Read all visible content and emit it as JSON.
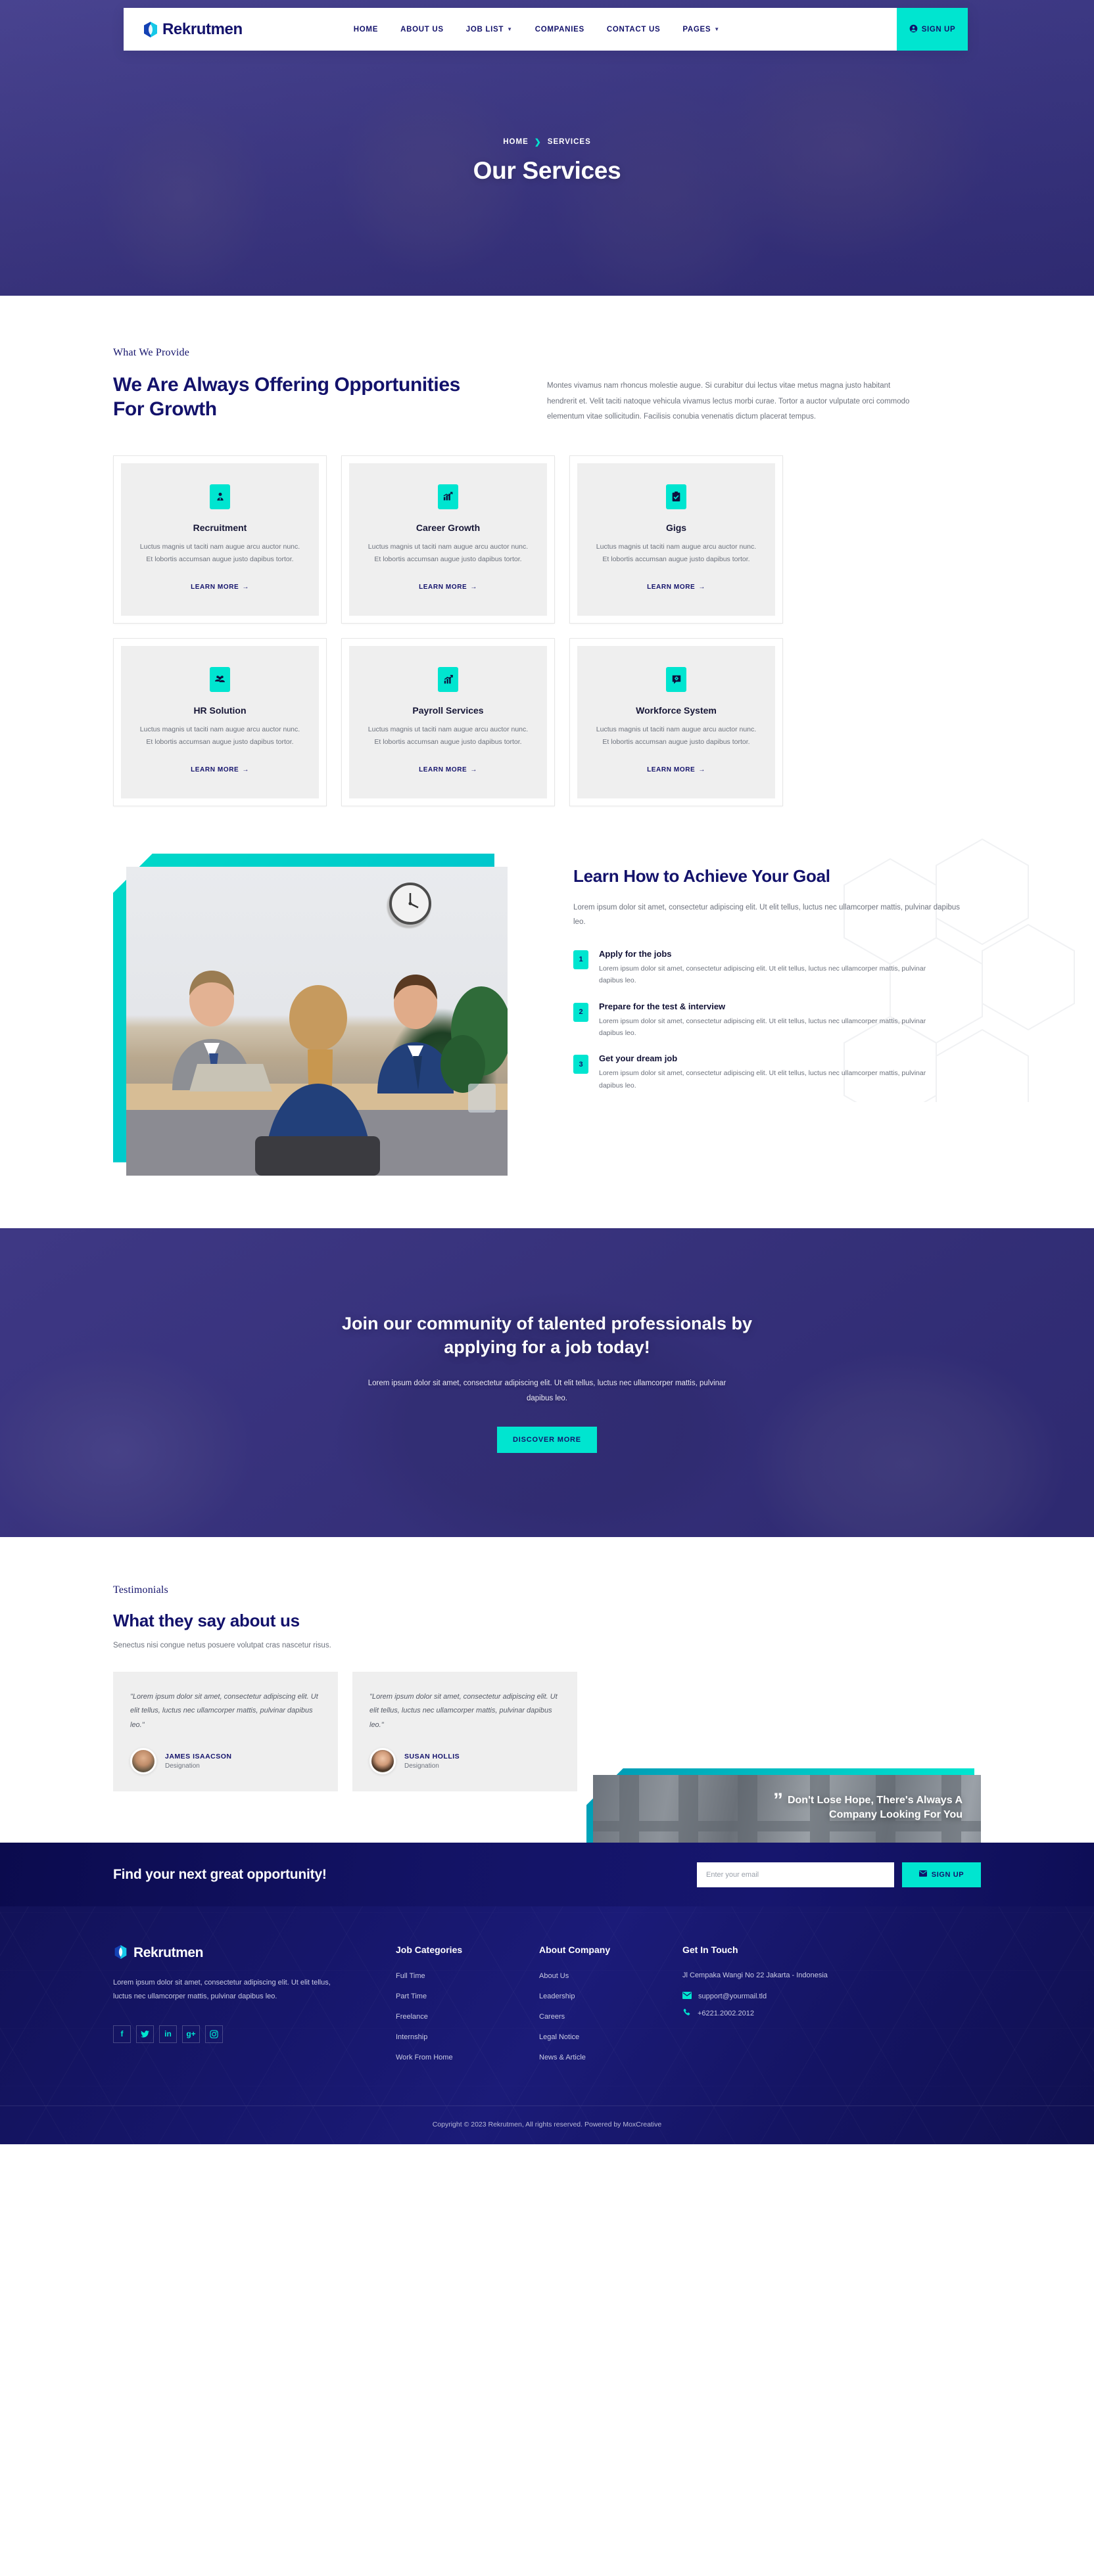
{
  "colors": {
    "navy": "#13126b",
    "teal": "#00e5d0",
    "card_bg": "#efefef",
    "footer_bg": "#16166a"
  },
  "navbar": {
    "brand": "Rekrutmen",
    "links": [
      {
        "label": "HOME",
        "caret": false
      },
      {
        "label": "ABOUT US",
        "caret": false
      },
      {
        "label": "JOB LIST",
        "caret": true
      },
      {
        "label": "COMPANIES",
        "caret": false
      },
      {
        "label": "CONTACT US",
        "caret": false
      },
      {
        "label": "PAGES",
        "caret": true
      }
    ],
    "signup_label": "SIGN UP"
  },
  "hero": {
    "breadcrumb_home": "HOME",
    "breadcrumb_sep": "❯",
    "breadcrumb_current": "SERVICES",
    "title": "Our Services"
  },
  "provide": {
    "eyebrow": "What We Provide",
    "heading": "We Are Always Offering Opportunities For Growth",
    "paragraph": "Montes vivamus nam rhoncus molestie augue. Si curabitur dui lectus vitae metus magna justo habitant hendrerit et. Velit taciti natoque vehicula vivamus lectus morbi curae. Tortor a auctor vulputate orci commodo elementum vitae sollicitudin. Facilisis conubia venenatis dictum placerat tempus.",
    "learn_more": "LEARN MORE",
    "cards": [
      {
        "icon": "user-tie-icon",
        "title": "Recruitment",
        "desc": "Luctus magnis ut taciti nam augue arcu auctor nunc. Et lobortis accumsan augue justo dapibus tortor."
      },
      {
        "icon": "chart-growth-icon",
        "title": "Career Growth",
        "desc": "Luctus magnis ut taciti nam augue arcu auctor nunc. Et lobortis accumsan augue justo dapibus tortor."
      },
      {
        "icon": "clipboard-check-icon",
        "title": "Gigs",
        "desc": "Luctus magnis ut taciti nam augue arcu auctor nunc. Et lobortis accumsan augue justo dapibus tortor."
      },
      {
        "icon": "users-group-icon",
        "title": "HR Solution",
        "desc": "Luctus magnis ut taciti nam augue arcu auctor nunc. Et lobortis accumsan augue justo dapibus tortor."
      },
      {
        "icon": "chart-arrow-icon",
        "title": "Payroll Services",
        "desc": "Luctus magnis ut taciti nam augue arcu auctor nunc. Et lobortis accumsan augue justo dapibus tortor."
      },
      {
        "icon": "chat-gear-icon",
        "title": "Workforce System",
        "desc": "Luctus magnis ut taciti nam augue arcu auctor nunc. Et lobortis accumsan augue justo dapibus tortor."
      }
    ]
  },
  "achieve": {
    "heading": "Learn How to Achieve Your Goal",
    "lead": "Lorem ipsum dolor sit amet, consectetur adipiscing elit. Ut elit tellus, luctus nec ullamcorper mattis, pulvinar dapibus leo.",
    "steps": [
      {
        "num": "1",
        "title": "Apply for the jobs",
        "desc": "Lorem ipsum dolor sit amet, consectetur adipiscing elit. Ut elit tellus, luctus nec ullamcorper mattis, pulvinar dapibus leo."
      },
      {
        "num": "2",
        "title": "Prepare for the test & interview",
        "desc": "Lorem ipsum dolor sit amet, consectetur adipiscing elit. Ut elit tellus, luctus nec ullamcorper mattis, pulvinar dapibus leo."
      },
      {
        "num": "3",
        "title": "Get your dream job",
        "desc": "Lorem ipsum dolor sit amet, consectetur adipiscing elit. Ut elit tellus, luctus nec ullamcorper mattis, pulvinar dapibus leo."
      }
    ]
  },
  "cta": {
    "heading": "Join our community of talented professionals by applying for a job today!",
    "paragraph": "Lorem ipsum dolor sit amet, consectetur adipiscing elit. Ut elit tellus, luctus nec ullamcorper mattis, pulvinar dapibus leo.",
    "button": "DISCOVER MORE"
  },
  "testimonials": {
    "eyebrow": "Testimonials",
    "heading": "What they say about us",
    "sub": "Senectus nisi congue netus posuere volutpat cras nascetur risus.",
    "overlay_quote_mark": "”",
    "overlay_text": "Don't Lose Hope, There's Always A Company Looking For You",
    "items": [
      {
        "quote": "\"Lorem ipsum dolor sit amet, consectetur adipiscing elit. Ut elit tellus, luctus nec ullamcorper mattis, pulvinar dapibus leo.\"",
        "name": "JAMES ISAACSON",
        "role": "Designation"
      },
      {
        "quote": "\"Lorem ipsum dolor sit amet, consectetur adipiscing elit. Ut elit tellus, luctus nec ullamcorper mattis, pulvinar dapibus leo.\"",
        "name": "SUSAN HOLLIS",
        "role": "Designation"
      }
    ]
  },
  "newsletter": {
    "title": "Find your next great opportunity!",
    "input_value": "",
    "input_placeholder": "Enter your email",
    "button": "SIGN UP"
  },
  "footer": {
    "brand": "Rekrutmen",
    "about": "Lorem ipsum dolor sit amet, consectetur adipiscing elit. Ut elit tellus, luctus nec ullamcorper mattis, pulvinar dapibus leo.",
    "socials": [
      {
        "name": "facebook-icon",
        "glyph": "f"
      },
      {
        "name": "twitter-icon",
        "glyph": "ᴠ"
      },
      {
        "name": "linkedin-icon",
        "glyph": "in"
      },
      {
        "name": "google-plus-icon",
        "glyph": "g+"
      },
      {
        "name": "instagram-icon",
        "glyph": "□"
      }
    ],
    "col_jobs": {
      "title": "Job Categories",
      "items": [
        "Full Time",
        "Part Time",
        "Freelance",
        "Internship",
        "Work From Home"
      ]
    },
    "col_about": {
      "title": "About Company",
      "items": [
        "About Us",
        "Leadership",
        "Careers",
        "Legal Notice",
        "News & Article"
      ]
    },
    "col_touch": {
      "title": "Get In Touch",
      "address": "Jl Cempaka Wangi No 22 Jakarta - Indonesia",
      "email": "support@yourmail.tld",
      "phone": "+6221.2002.2012"
    },
    "copyright": "Copyright © 2023 Rekrutmen, All rights reserved. Powered by MoxCreative"
  }
}
